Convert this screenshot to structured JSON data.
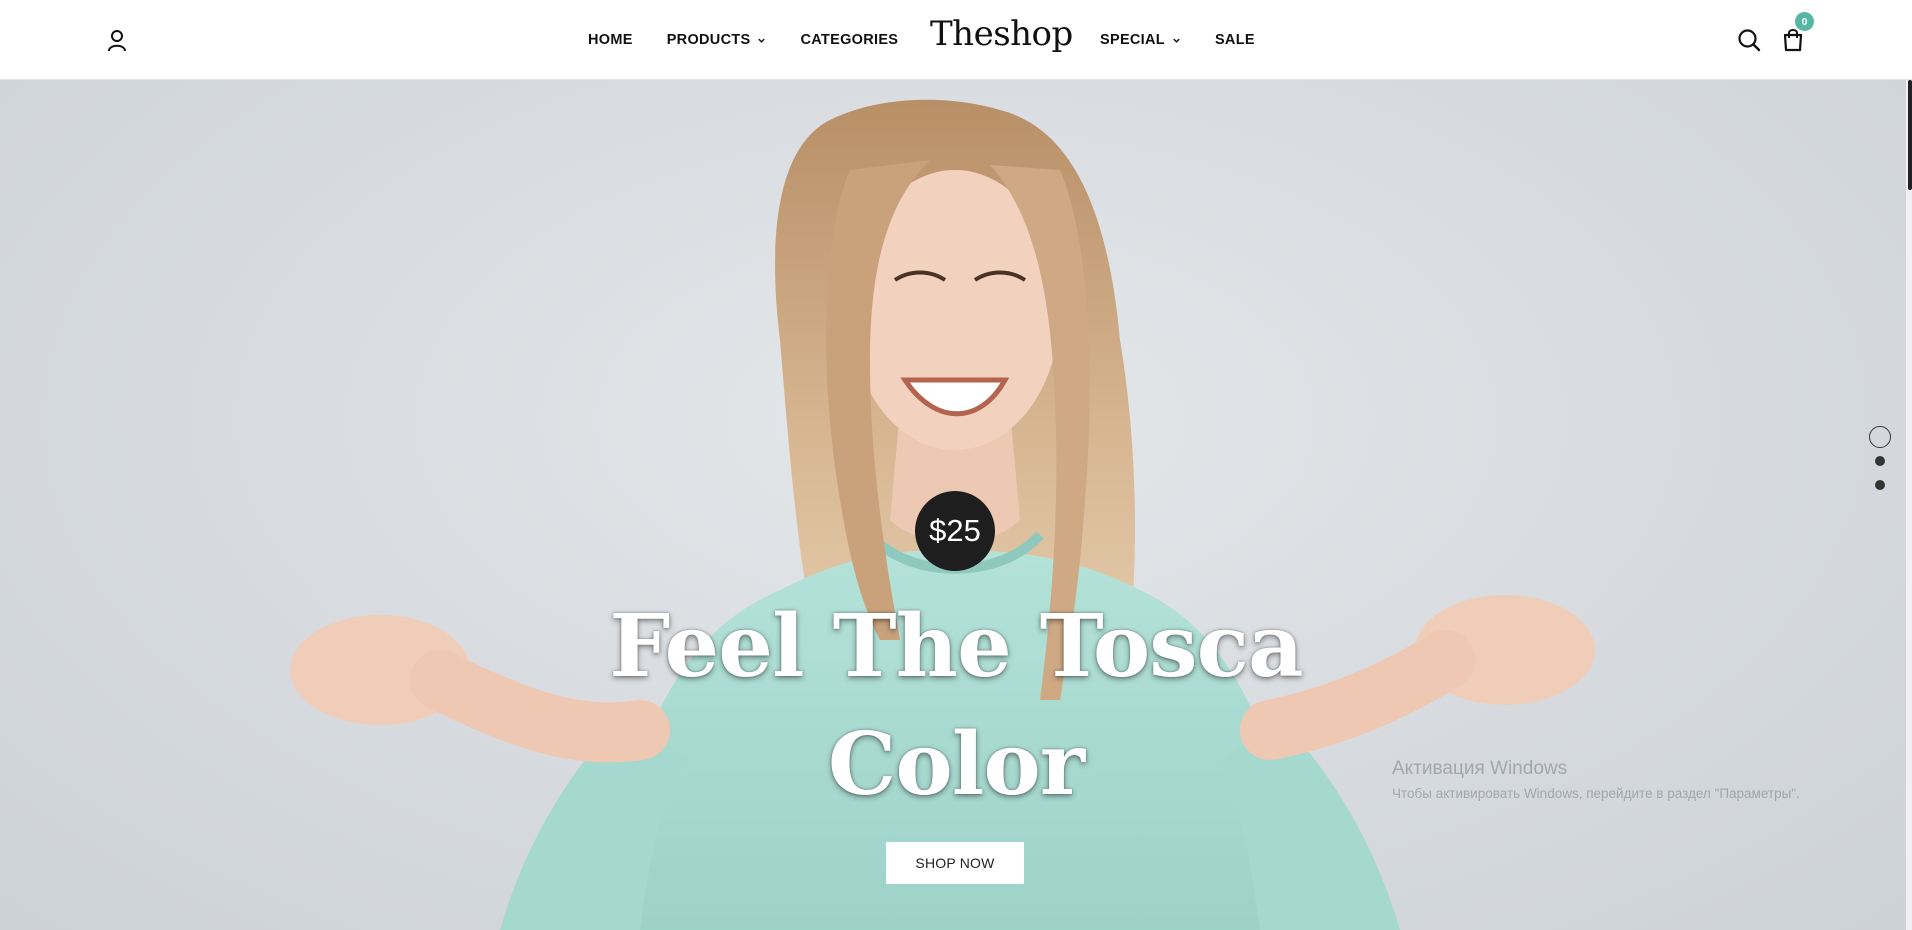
{
  "header": {
    "logo": "Theshop",
    "nav_left": [
      {
        "label": "HOME",
        "has_dropdown": false
      },
      {
        "label": "PRODUCTS",
        "has_dropdown": true
      },
      {
        "label": "CATEGORIES",
        "has_dropdown": false
      }
    ],
    "nav_right": [
      {
        "label": "SPECIAL",
        "has_dropdown": true
      },
      {
        "label": "SALE",
        "has_dropdown": false
      }
    ],
    "icons": {
      "account": "user-icon",
      "search": "search-icon",
      "cart": "shopping-bag-icon"
    },
    "cart_count": "0",
    "badge_color": "#56b7a6"
  },
  "hero": {
    "price": "$25",
    "title": "Feel The Tosca Color",
    "cta_label": "SHOP NOW",
    "slider": {
      "total_slides": 3,
      "active_slide": 1
    }
  },
  "watermark": {
    "title": "Активация Windows",
    "subtitle": "Чтобы активировать Windows, перейдите в раздел \"Параметры\"."
  },
  "colors": {
    "accent": "#56b7a6",
    "hero_bg": "#d9dde1",
    "sweater": "#a9dcd3",
    "dark": "#1e1e1e"
  }
}
